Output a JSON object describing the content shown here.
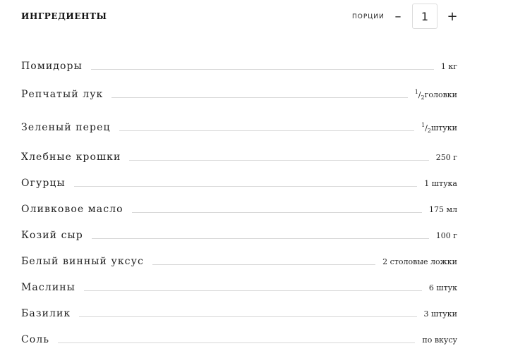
{
  "header": {
    "title": "ИНГРЕДИЕНТЫ",
    "servings_label": "ПОРЦИИ",
    "minus_label": "–",
    "plus_label": "+",
    "servings_value": "1"
  },
  "ingredients": [
    {
      "name": "Помидоры",
      "qty": "1 кг"
    },
    {
      "name": "Репчатый лук",
      "qty_num": "1",
      "qty_slash": "/",
      "qty_den": "2",
      "qty_unit": "головки"
    },
    {
      "name": "Зеленый перец",
      "qty_num": "1",
      "qty_slash": "/",
      "qty_den": "2",
      "qty_unit": "штуки"
    },
    {
      "name": "Хлебные крошки",
      "qty": "250 г"
    },
    {
      "name": "Огурцы",
      "qty": "1 штука"
    },
    {
      "name": "Оливковое масло",
      "qty": "175 мл"
    },
    {
      "name": "Козий сыр",
      "qty": "100 г"
    },
    {
      "name": "Белый винный уксус",
      "qty": "2 столовые ложки"
    },
    {
      "name": "Маслины",
      "qty": "6 штук"
    },
    {
      "name": "Базилик",
      "qty": "3 штуки"
    },
    {
      "name": "Соль",
      "qty": "по вкусу"
    }
  ]
}
